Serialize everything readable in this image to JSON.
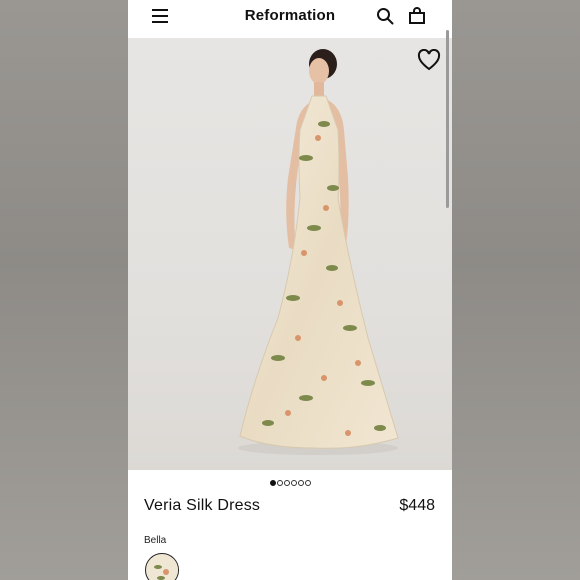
{
  "header": {
    "brand": "Reformation",
    "menu_icon": "menu-icon",
    "search_icon": "search-icon",
    "bag_icon": "shopping-bag-icon"
  },
  "gallery": {
    "image_alt": "Model wearing floral halter silk maxi dress",
    "favorite_icon": "heart-icon",
    "slide_count": 6,
    "active_slide": 1
  },
  "product": {
    "name": "Veria Silk Dress",
    "price": "$448",
    "color_label": "Bella"
  },
  "colors": {
    "accent": "#111111",
    "background": "#ffffff",
    "dress_base": "#efe3cc"
  }
}
